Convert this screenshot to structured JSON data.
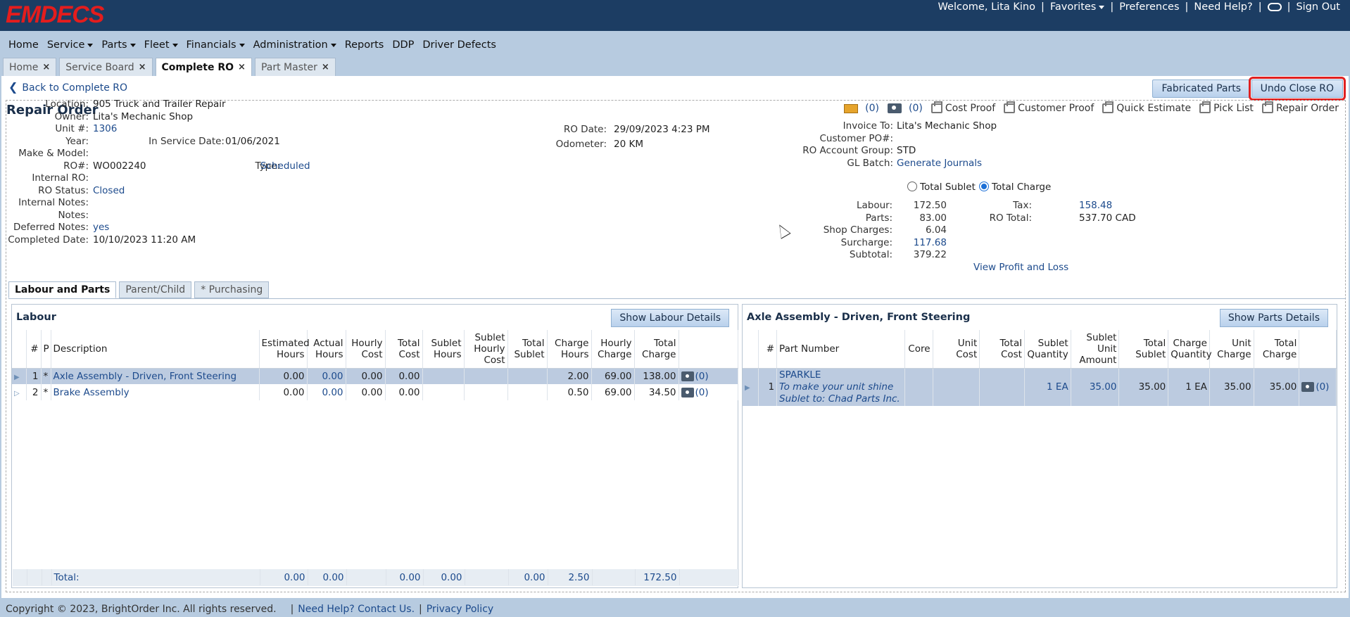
{
  "app": {
    "logo": "EMDECS"
  },
  "header": {
    "welcome": "Welcome, Lita Kino",
    "favorites": "Favorites",
    "preferences": "Preferences",
    "help": "Need Help?",
    "signout": "Sign Out",
    "sep": "|"
  },
  "nav": [
    "Home",
    "Service",
    "Parts",
    "Fleet",
    "Financials",
    "Administration",
    "Reports",
    "DDP",
    "Driver Defects"
  ],
  "tabs": [
    "Home",
    "Service Board",
    "Complete RO",
    "Part Master"
  ],
  "back_link": "Back to Complete RO",
  "buttons": {
    "fabricated": "Fabricated Parts",
    "undo_close": "Undo Close RO"
  },
  "ro_title": "Repair Order",
  "print": {
    "mail_count": "(0)",
    "cam_count": "(0)",
    "cost_proof": "Cost Proof",
    "customer_proof": "Customer Proof",
    "quick_estimate": "Quick Estimate",
    "pick_list": "Pick List",
    "repair_order": "Repair Order"
  },
  "left_fields": {
    "location_l": "Location:",
    "location": "905 Truck and Trailer Repair",
    "owner_l": "Owner:",
    "owner": "Lita's Mechanic Shop",
    "unit_l": "Unit #:",
    "unit": "1306",
    "year_l": "Year:",
    "service_date_l": "In Service Date:",
    "service_date": "01/06/2021",
    "make_l": "Make & Model:",
    "ro_l": "RO#:",
    "ro": "WO002240",
    "type_l": "Type:",
    "type": "Scheduled",
    "internal_ro_l": "Internal RO:",
    "status_l": "RO Status:",
    "status": "Closed",
    "internal_notes_l": "Internal Notes:",
    "notes_l": "Notes:",
    "deferred_l": "Deferred Notes:",
    "deferred": "yes",
    "completed_l": "Completed Date:",
    "completed": "10/10/2023 11:20 AM"
  },
  "mid_fields": {
    "ro_date_l": "RO Date:",
    "ro_date": "29/09/2023 4:23 PM",
    "odometer_l": "Odometer:",
    "odometer": "20 KM"
  },
  "right_fields": {
    "invoice_l": "Invoice To:",
    "invoice": "Lita's Mechanic Shop",
    "po_l": "Customer PO#:",
    "group_l": "RO Account Group:",
    "group": "STD",
    "gl_l": "GL Batch:",
    "gl": "Generate Journals",
    "total_sublet": "Total Sublet",
    "total_charge": "Total Charge",
    "labour_l": "Labour:",
    "labour": "172.50",
    "parts_l": "Parts:",
    "parts": "83.00",
    "shop_l": "Shop Charges:",
    "shop": "6.04",
    "surcharge_l": "Surcharge:",
    "surcharge": "117.68",
    "subtotal_l": "Subtotal:",
    "subtotal": "379.22",
    "tax_l": "Tax:",
    "tax": "158.48",
    "ro_total_l": "RO Total:",
    "ro_total": "537.70 CAD",
    "profit": "View Profit and Loss"
  },
  "subtabs": [
    "Labour and Parts",
    "Parent/Child",
    "* Purchasing"
  ],
  "labour": {
    "title": "Labour",
    "show_btn": "Show Labour Details",
    "headers": [
      "#",
      "P",
      "Description",
      "Estimated Hours",
      "Actual Hours",
      "Hourly Cost",
      "Total Cost",
      "Sublet Hours",
      "Sublet Hourly Cost",
      "Total Sublet",
      "Charge Hours",
      "Hourly Charge",
      "Total Charge"
    ],
    "rows": [
      {
        "n": "1",
        "p": "*",
        "desc": "Axle Assembly - Driven, Front Steering",
        "est": "0.00",
        "act": "0.00",
        "hc": "0.00",
        "tc": "0.00",
        "sh": "",
        "shc": "",
        "ts": "",
        "ch": "2.00",
        "hch": "69.00",
        "tch": "138.00",
        "att": "(0)"
      },
      {
        "n": "2",
        "p": "*",
        "desc": "Brake Assembly",
        "est": "0.00",
        "act": "0.00",
        "hc": "0.00",
        "tc": "0.00",
        "sh": "",
        "shc": "",
        "ts": "",
        "ch": "0.50",
        "hch": "69.00",
        "tch": "34.50",
        "att": "(0)"
      }
    ],
    "total": {
      "label": "Total:",
      "est": "0.00",
      "act": "0.00",
      "tc": "0.00",
      "sh": "0.00",
      "ts": "0.00",
      "ch": "2.50",
      "tch": "172.50"
    }
  },
  "parts": {
    "title": "Axle Assembly - Driven, Front Steering",
    "show_btn": "Show Parts Details",
    "headers": [
      "#",
      "Part Number",
      "Core",
      "Unit Cost",
      "Total Cost",
      "Sublet Quantity",
      "Sublet Unit Amount",
      "Total Sublet",
      "Charge Quantity",
      "Unit Charge",
      "Total Charge"
    ],
    "row": {
      "n": "1",
      "part": "SPARKLE",
      "desc": "To make your unit shine",
      "sublet_to": "Sublet to:  Chad Parts Inc.",
      "sq": "1 EA",
      "sua": "35.00",
      "ts": "35.00",
      "cq": "1 EA",
      "uc": "35.00",
      "tch": "35.00",
      "att": "(0)"
    }
  },
  "footer": {
    "copyright": "Copyright © 2023, BrightOrder Inc. All rights reserved.",
    "contact": "Need Help? Contact Us.",
    "privacy": "Privacy Policy"
  }
}
